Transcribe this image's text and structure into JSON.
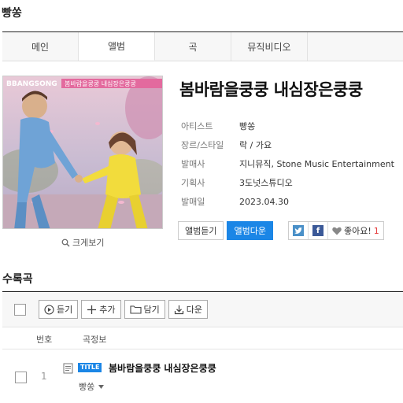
{
  "header": {
    "title": "빵쏭"
  },
  "tabs": [
    {
      "label": "메인",
      "active": false
    },
    {
      "label": "앨범",
      "active": true
    },
    {
      "label": "곡",
      "active": false
    },
    {
      "label": "뮤직비디오",
      "active": false
    }
  ],
  "album": {
    "cover_text": {
      "brand": "BBANGSONG",
      "subtitle": "봄바람을쿵쿵 내심장은쿵쿵"
    },
    "zoom_label": "크게보기",
    "title": "봄바람을쿵쿵 내심장은쿵쿵",
    "info": [
      {
        "label": "아티스트",
        "value": "빵쏭"
      },
      {
        "label": "장르/스타일",
        "value": "락 / 가요"
      },
      {
        "label": "발매사",
        "value": "지니뮤직, Stone Music Entertainment"
      },
      {
        "label": "기획사",
        "value": "3도넛스튜디오"
      },
      {
        "label": "발매일",
        "value": "2023.04.30"
      }
    ],
    "actions": {
      "listen": "앨범듣기",
      "download": "앨범다운"
    },
    "social": {
      "twitter_icon": "twitter-icon",
      "facebook_icon": "facebook-icon",
      "like_label": "좋아요!",
      "like_count": "1"
    }
  },
  "tracks": {
    "section_title": "수록곡",
    "toolbar": {
      "play": "듣기",
      "add": "추가",
      "save": "담기",
      "download": "다운"
    },
    "columns": {
      "number": "번호",
      "info": "곡정보"
    },
    "rows": [
      {
        "number": "1",
        "badge": "TITLE",
        "title": "봄바람을쿵쿵 내심장은쿵쿵",
        "artist": "빵쏭"
      }
    ]
  },
  "colors": {
    "accent": "#1b86e6",
    "like": "#e63b3b",
    "twitter": "#4a90c8",
    "facebook": "#3b5998"
  }
}
